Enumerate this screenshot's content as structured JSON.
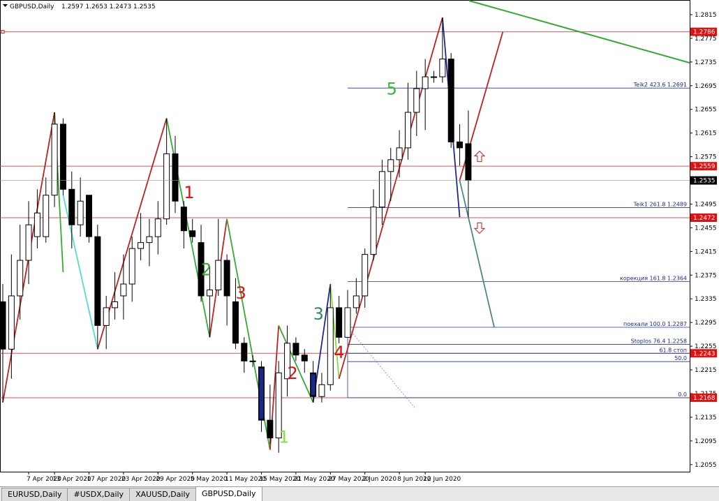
{
  "header": {
    "symbol": "GBPUSD,Daily",
    "ohlc": "1.2597 1.2653 1.2473 1.2535"
  },
  "chart_data": {
    "type": "candlestick",
    "y_ticks": [
      "1.2815",
      "1.2775",
      "1.2735",
      "1.2695",
      "1.2655",
      "1.2615",
      "1.2575",
      "1.2535",
      "1.2495",
      "1.2455",
      "1.2415",
      "1.2375",
      "1.2335",
      "1.2295",
      "1.2255",
      "1.2215",
      "1.2175",
      "1.2135",
      "1.2095",
      "1.2055"
    ],
    "x_ticks": [
      "7 Apr 2020",
      "13 Apr 2020",
      "17 Apr 2020",
      "23 Apr 2020",
      "29 Apr 2020",
      "5 May 2020",
      "11 May 2020",
      "15 May 2020",
      "21 May 2020",
      "27 May 2020",
      "2 Jun 2020",
      "8 Jun 2020",
      "12 Jun 2020"
    ],
    "price_badges": [
      {
        "value": 1.2786,
        "label": "1.2786",
        "color": "#e01010"
      },
      {
        "value": 1.2559,
        "label": "1.2559",
        "color": "#e01010"
      },
      {
        "value": 1.2535,
        "label": "1.2535",
        "color": "#000000"
      },
      {
        "value": 1.2472,
        "label": "1.2472",
        "color": "#e01010"
      },
      {
        "value": 1.2243,
        "label": "1.2243",
        "color": "#e01010"
      },
      {
        "value": 1.2168,
        "label": "1.2168",
        "color": "#e01010"
      }
    ],
    "horizontal_lines": [
      {
        "value": 1.2786,
        "color": "#e05050"
      },
      {
        "value": 1.2559,
        "color": "#e05050"
      },
      {
        "value": 1.2472,
        "color": "#e05050"
      },
      {
        "value": 1.2243,
        "color": "#e05050"
      },
      {
        "value": 1.2168,
        "color": "#e05050"
      }
    ],
    "fib_levels": [
      {
        "value": 1.2691,
        "label": "Teik2 423.6  1.2691"
      },
      {
        "value": 1.2489,
        "label": "Teik1 261.8  1.2489"
      },
      {
        "value": 1.2364,
        "label": "корекция 161.8  1.2364"
      },
      {
        "value": 1.2287,
        "label": "поехали 100.0  1.2287"
      },
      {
        "value": 1.2258,
        "label": "Stoplos 76.4  1.2258"
      },
      {
        "value": 1.2243,
        "label": "61.8 стоп"
      },
      {
        "value": 1.2229,
        "label": "50.0"
      },
      {
        "value": 1.2168,
        "label": "0.0"
      }
    ],
    "wave_labels": [
      {
        "text": "1",
        "color": "#e01010",
        "i": 21,
        "v": 1.2505
      },
      {
        "text": "2",
        "color": "#33aa33",
        "i": 23,
        "v": 1.2375
      },
      {
        "text": "3",
        "color": "#e01010",
        "i": 27,
        "v": 1.2335
      },
      {
        "text": "1",
        "color": "#88dd44",
        "i": 32,
        "v": 1.2092
      },
      {
        "text": "2",
        "color": "#e01010",
        "i": 33,
        "v": 1.22
      },
      {
        "text": "3",
        "color": "#338855",
        "i": 36,
        "v": 1.23
      },
      {
        "text": "4",
        "color": "#e01010",
        "i": 38.4,
        "v": 1.2235
      },
      {
        "text": "5",
        "color": "#33bb33",
        "i": 44.5,
        "v": 1.268
      }
    ],
    "arrows": [
      {
        "dir": "up",
        "i": 55.3,
        "v": 1.2575
      },
      {
        "dir": "down",
        "i": 55.3,
        "v": 1.2455
      }
    ],
    "candles": [
      {
        "d": "2020-04-03",
        "o": 1.233,
        "h": 1.236,
        "l": 1.216,
        "c": 1.225
      },
      {
        "d": "2020-04-06",
        "o": 1.225,
        "h": 1.241,
        "l": 1.22,
        "c": 1.234
      },
      {
        "d": "2020-04-07",
        "o": 1.234,
        "h": 1.246,
        "l": 1.23,
        "c": 1.24
      },
      {
        "d": "2020-04-08",
        "o": 1.24,
        "h": 1.25,
        "l": 1.236,
        "c": 1.246
      },
      {
        "d": "2020-04-09",
        "o": 1.244,
        "h": 1.252,
        "l": 1.242,
        "c": 1.248
      },
      {
        "d": "2020-04-10",
        "o": 1.244,
        "h": 1.254,
        "l": 1.243,
        "c": 1.251
      },
      {
        "d": "2020-04-13",
        "o": 1.251,
        "h": 1.265,
        "l": 1.249,
        "c": 1.263
      },
      {
        "d": "2020-04-14",
        "o": 1.263,
        "h": 1.264,
        "l": 1.251,
        "c": 1.252
      },
      {
        "d": "2020-04-15",
        "o": 1.252,
        "h": 1.255,
        "l": 1.242,
        "c": 1.246
      },
      {
        "d": "2020-04-16",
        "o": 1.246,
        "h": 1.254,
        "l": 1.244,
        "c": 1.25
      },
      {
        "d": "2020-04-17",
        "o": 1.251,
        "h": 1.251,
        "l": 1.243,
        "c": 1.244
      },
      {
        "d": "2020-04-20",
        "o": 1.244,
        "h": 1.246,
        "l": 1.225,
        "c": 1.229
      },
      {
        "d": "2020-04-21",
        "o": 1.229,
        "h": 1.234,
        "l": 1.225,
        "c": 1.232
      },
      {
        "d": "2020-04-22",
        "o": 1.232,
        "h": 1.238,
        "l": 1.23,
        "c": 1.233
      },
      {
        "d": "2020-04-23",
        "o": 1.234,
        "h": 1.241,
        "l": 1.23,
        "c": 1.236
      },
      {
        "d": "2020-04-24",
        "o": 1.236,
        "h": 1.244,
        "l": 1.233,
        "c": 1.242
      },
      {
        "d": "2020-04-27",
        "o": 1.242,
        "h": 1.248,
        "l": 1.24,
        "c": 1.243
      },
      {
        "d": "2020-04-28",
        "o": 1.243,
        "h": 1.247,
        "l": 1.239,
        "c": 1.244
      },
      {
        "d": "2020-04-29",
        "o": 1.244,
        "h": 1.25,
        "l": 1.241,
        "c": 1.247
      },
      {
        "d": "2020-04-30",
        "o": 1.247,
        "h": 1.264,
        "l": 1.246,
        "c": 1.258
      },
      {
        "d": "2020-05-01",
        "o": 1.258,
        "h": 1.261,
        "l": 1.248,
        "c": 1.25
      },
      {
        "d": "2020-05-04",
        "o": 1.249,
        "h": 1.25,
        "l": 1.242,
        "c": 1.245
      },
      {
        "d": "2020-05-05",
        "o": 1.245,
        "h": 1.247,
        "l": 1.243,
        "c": 1.244
      },
      {
        "d": "2020-05-06",
        "o": 1.243,
        "h": 1.246,
        "l": 1.233,
        "c": 1.234
      },
      {
        "d": "2020-05-07",
        "o": 1.234,
        "h": 1.239,
        "l": 1.227,
        "c": 1.235
      },
      {
        "d": "2020-05-08",
        "o": 1.235,
        "h": 1.247,
        "l": 1.234,
        "c": 1.24
      },
      {
        "d": "2020-05-11",
        "o": 1.24,
        "h": 1.241,
        "l": 1.229,
        "c": 1.234
      },
      {
        "d": "2020-05-12",
        "o": 1.233,
        "h": 1.237,
        "l": 1.225,
        "c": 1.226
      },
      {
        "d": "2020-05-13",
        "o": 1.226,
        "h": 1.227,
        "l": 1.221,
        "c": 1.223
      },
      {
        "d": "2020-05-14",
        "o": 1.223,
        "h": 1.224,
        "l": 1.222,
        "c": 1.223
      },
      {
        "d": "2020-05-15",
        "o": 1.222,
        "h": 1.223,
        "l": 1.211,
        "c": 1.213
      },
      {
        "d": "2020-05-18",
        "o": 1.213,
        "h": 1.219,
        "l": 1.209,
        "c": 1.21
      },
      {
        "d": "2020-05-19",
        "o": 1.21,
        "h": 1.223,
        "l": 1.2075,
        "c": 1.221
      },
      {
        "d": "2020-05-20",
        "o": 1.22,
        "h": 1.229,
        "l": 1.217,
        "c": 1.226
      },
      {
        "d": "2020-05-21",
        "o": 1.226,
        "h": 1.227,
        "l": 1.223,
        "c": 1.224
      },
      {
        "d": "2020-05-22",
        "o": 1.224,
        "h": 1.225,
        "l": 1.221,
        "c": 1.223
      },
      {
        "d": "2020-05-25",
        "o": 1.221,
        "h": 1.223,
        "l": 1.216,
        "c": 1.217
      },
      {
        "d": "2020-05-26",
        "o": 1.217,
        "h": 1.221,
        "l": 1.216,
        "c": 1.219
      },
      {
        "d": "2020-05-27",
        "o": 1.219,
        "h": 1.236,
        "l": 1.218,
        "c": 1.232
      },
      {
        "d": "2020-05-28",
        "o": 1.232,
        "h": 1.234,
        "l": 1.226,
        "c": 1.227
      },
      {
        "d": "2020-05-29",
        "o": 1.227,
        "h": 1.235,
        "l": 1.227,
        "c": 1.232
      },
      {
        "d": "2020-06-01",
        "o": 1.232,
        "h": 1.237,
        "l": 1.231,
        "c": 1.234
      },
      {
        "d": "2020-06-02",
        "o": 1.234,
        "h": 1.242,
        "l": 1.232,
        "c": 1.241
      },
      {
        "d": "2020-06-03",
        "o": 1.241,
        "h": 1.252,
        "l": 1.24,
        "c": 1.249
      },
      {
        "d": "2020-06-04",
        "o": 1.249,
        "h": 1.257,
        "l": 1.246,
        "c": 1.255
      },
      {
        "d": "2020-06-05",
        "o": 1.255,
        "h": 1.259,
        "l": 1.25,
        "c": 1.257
      },
      {
        "d": "2020-06-08",
        "o": 1.257,
        "h": 1.262,
        "l": 1.254,
        "c": 1.259
      },
      {
        "d": "2020-06-09",
        "o": 1.259,
        "h": 1.27,
        "l": 1.257,
        "c": 1.265
      },
      {
        "d": "2020-06-10",
        "o": 1.265,
        "h": 1.272,
        "l": 1.261,
        "c": 1.269
      },
      {
        "d": "2020-06-11",
        "o": 1.269,
        "h": 1.274,
        "l": 1.262,
        "c": 1.271
      },
      {
        "d": "2020-06-12",
        "o": 1.271,
        "h": 1.272,
        "l": 1.27,
        "c": 1.271
      },
      {
        "d": "2020-06-15",
        "o": 1.271,
        "h": 1.281,
        "l": 1.27,
        "c": 1.274
      },
      {
        "d": "2020-06-16",
        "o": 1.274,
        "h": 1.275,
        "l": 1.259,
        "c": 1.26
      },
      {
        "d": "2020-06-17",
        "o": 1.26,
        "h": 1.263,
        "l": 1.256,
        "c": 1.259
      },
      {
        "d": "2020-06-18",
        "o": 1.2597,
        "h": 1.2653,
        "l": 1.2473,
        "c": 1.2535
      }
    ],
    "zigzag": [
      {
        "i": 0,
        "v": 1.216,
        "color": "#bb2222"
      },
      {
        "i": 6,
        "v": 1.265,
        "color": "#bb2222"
      },
      {
        "i": 6,
        "v": 1.265,
        "color": "#33aa33",
        "to": {
          "i": 7,
          "v": 1.238
        }
      },
      {
        "i": 7,
        "v": 1.251,
        "color": "#55ddcc",
        "to": {
          "i": 11,
          "v": 1.225
        }
      },
      {
        "i": 11,
        "v": 1.225,
        "color": "#bb2222",
        "to": {
          "i": 19,
          "v": 1.264
        }
      },
      {
        "i": 19,
        "v": 1.264,
        "color": "#33aa33",
        "to": {
          "i": 22,
          "v": 1.242
        }
      },
      {
        "i": 22,
        "v": 1.242,
        "color": "#33aa33",
        "to": {
          "i": 24,
          "v": 1.227
        }
      },
      {
        "i": 24,
        "v": 1.227,
        "color": "#bb2222",
        "to": {
          "i": 26,
          "v": 1.247
        }
      },
      {
        "i": 26,
        "v": 1.247,
        "color": "#33aa33",
        "to": {
          "i": 31,
          "v": 1.208
        }
      },
      {
        "i": 31,
        "v": 1.208,
        "color": "#bb2222",
        "to": {
          "i": 32,
          "v": 1.229
        }
      },
      {
        "i": 32,
        "v": 1.229,
        "color": "#33aa33",
        "to": {
          "i": 36,
          "v": 1.216
        }
      },
      {
        "i": 36,
        "v": 1.216,
        "color": "#1b2a8a",
        "to": {
          "i": 38,
          "v": 1.236
        }
      },
      {
        "i": 38,
        "v": 1.236,
        "color": "#88dd44",
        "to": {
          "i": 39,
          "v": 1.22
        }
      },
      {
        "i": 39,
        "v": 1.22,
        "color": "#bb2222",
        "to": {
          "i": 51,
          "v": 1.281
        }
      },
      {
        "i": 51,
        "v": 1.281,
        "color": "#1b2a8a",
        "to": {
          "i": 53,
          "v": 1.2473
        }
      },
      {
        "i": 53,
        "v": 1.2535,
        "color": "#bb2222",
        "to": {
          "i": 58,
          "v": 1.2786
        }
      },
      {
        "i": 53,
        "v": 1.2535,
        "color": "#4a8888",
        "to": {
          "i": 57,
          "v": 1.2287
        }
      }
    ]
  },
  "tabs": [
    {
      "label": "EURUSD,Daily",
      "active": false
    },
    {
      "label": "#USDX,Daily",
      "active": false
    },
    {
      "label": "XAUUSD,Daily",
      "active": false
    },
    {
      "label": "GBPUSD,Daily",
      "active": true
    }
  ]
}
